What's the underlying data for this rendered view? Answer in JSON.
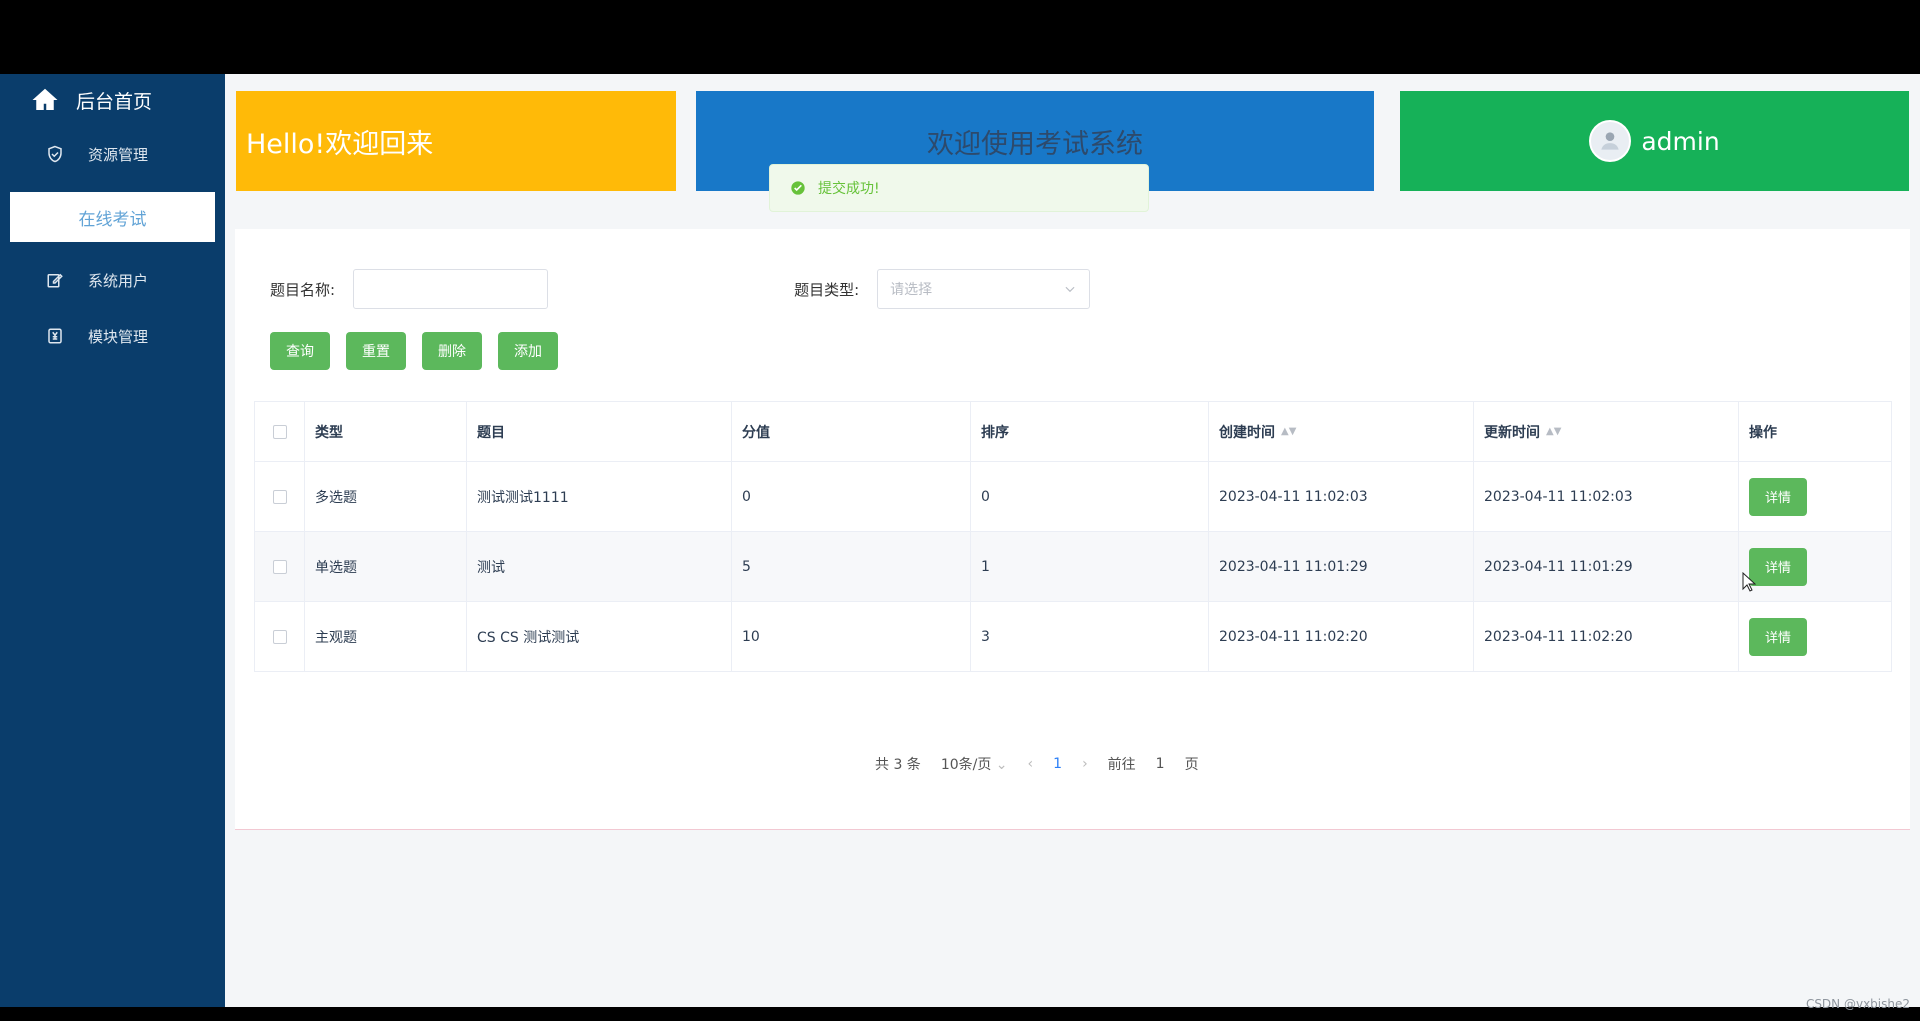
{
  "sidebar": {
    "header_label": "后台首页",
    "items": [
      {
        "label": "资源管理",
        "icon": "shield-icon"
      },
      {
        "label": "在线考试",
        "icon": "none"
      },
      {
        "label": "系统用户",
        "icon": "edit-icon"
      },
      {
        "label": "模块管理",
        "icon": "yen-icon"
      }
    ]
  },
  "cards": {
    "welcome_text": "Hello!欢迎回来",
    "system_text": "欢迎使用考试系统",
    "user_name": "admin"
  },
  "toast": {
    "message": "提交成功!"
  },
  "filters": {
    "name_label": "题目名称:",
    "type_label": "题目类型:",
    "type_placeholder": "请选择"
  },
  "buttons": {
    "query": "查询",
    "reset": "重置",
    "delete": "删除",
    "add": "添加"
  },
  "table": {
    "headers": [
      "类型",
      "题目",
      "分值",
      "排序",
      "创建时间",
      "更新时间",
      "操作"
    ],
    "rows": [
      {
        "type": "多选题",
        "question": "测试测试1111",
        "score": "0",
        "order": "0",
        "created": "2023-04-11 11:02:03",
        "updated": "2023-04-11 11:02:03",
        "action": "详情"
      },
      {
        "type": "单选题",
        "question": "测试",
        "score": "5",
        "order": "1",
        "created": "2023-04-11 11:01:29",
        "updated": "2023-04-11 11:01:29",
        "action": "详情"
      },
      {
        "type": "主观题",
        "question": "CS CS 测试测试",
        "score": "10",
        "order": "3",
        "created": "2023-04-11 11:02:20",
        "updated": "2023-04-11 11:02:20",
        "action": "详情"
      }
    ]
  },
  "pagination": {
    "total": "共 3 条",
    "page_size": "10条/页",
    "current_page": "1",
    "goto_label": "前往",
    "goto_value": "1",
    "page_suffix": "页"
  },
  "watermark": "CSDN @vxbishe2"
}
